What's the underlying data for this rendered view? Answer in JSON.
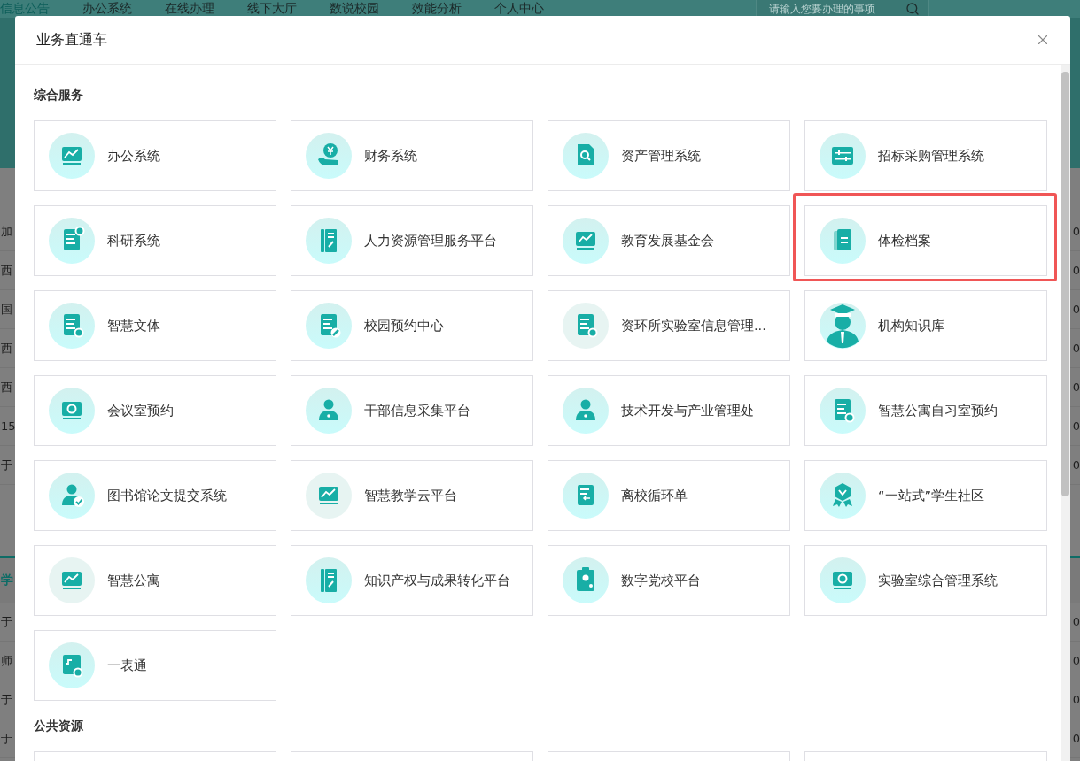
{
  "background_page": {
    "nav": [
      {
        "label": "信息公告",
        "selected": true
      },
      {
        "label": "办公系统",
        "selected": false
      },
      {
        "label": "在线办理",
        "selected": false
      },
      {
        "label": "线下大厅",
        "selected": false
      },
      {
        "label": "数说校园",
        "selected": false
      },
      {
        "label": "效能分析",
        "selected": false
      },
      {
        "label": "个人中心",
        "selected": false
      }
    ],
    "search": {
      "placeholder": "请输入您要办理的事项"
    },
    "list_1": {
      "rows": [
        {
          "column_1": "加",
          "column_2": "0"
        },
        {
          "column_1": "西",
          "column_2": "0"
        },
        {
          "column_1": "国",
          "column_2": "0"
        },
        {
          "column_1": "西",
          "column_2": "0"
        },
        {
          "column_1": "西",
          "column_2": "0"
        },
        {
          "column_1": "15",
          "column_2": "0"
        },
        {
          "column_1": "于",
          "column_2": "0"
        }
      ]
    },
    "list_2": {
      "heading": "学",
      "rows": [
        {
          "column_1": "于",
          "column_2": "0"
        },
        {
          "column_1": "师",
          "column_2": "0"
        },
        {
          "column_1": "于",
          "column_2": "0"
        },
        {
          "column_1": "于",
          "column_2": "0"
        }
      ]
    }
  },
  "dialog": {
    "title": "业务直通车",
    "sections": [
      {
        "title": "综合服务",
        "items": [
          {
            "kind": "app",
            "label": "办公系统",
            "highlighted": false
          },
          {
            "kind": "app",
            "label": "财务系统",
            "highlighted": false
          },
          {
            "kind": "app",
            "label": "资产管理系统",
            "highlighted": false
          },
          {
            "kind": "app",
            "label": "招标采购管理系统",
            "highlighted": false
          },
          {
            "kind": "app",
            "label": "科研系统",
            "highlighted": false
          },
          {
            "kind": "app",
            "label": "人力资源管理服务平台",
            "highlighted": false
          },
          {
            "kind": "app",
            "label": "教育发展基金会",
            "highlighted": false
          },
          {
            "kind": "app",
            "label": "体检档案",
            "highlighted": true
          },
          {
            "kind": "app",
            "label": "智慧文体",
            "highlighted": false
          },
          {
            "kind": "app",
            "label": "校园预约中心",
            "highlighted": false
          },
          {
            "kind": "app",
            "label": "资环所实验室信息管理...",
            "highlighted": false
          },
          {
            "kind": "app",
            "label": "机构知识库",
            "highlighted": false
          },
          {
            "kind": "app",
            "label": "会议室预约",
            "highlighted": false
          },
          {
            "kind": "app",
            "label": "干部信息采集平台",
            "highlighted": false
          },
          {
            "kind": "app",
            "label": "技术开发与产业管理处",
            "highlighted": false
          },
          {
            "kind": "app",
            "label": "智慧公寓自习室预约",
            "highlighted": false
          },
          {
            "kind": "app",
            "label": "图书馆论文提交系统",
            "highlighted": false
          },
          {
            "kind": "app",
            "label": "智慧教学云平台",
            "highlighted": false
          },
          {
            "kind": "app",
            "label": "离校循环单",
            "highlighted": false
          },
          {
            "kind": "app",
            "label": "“一站式”学生社区",
            "highlighted": false
          },
          {
            "kind": "app",
            "label": "智慧公寓",
            "highlighted": false
          },
          {
            "kind": "app",
            "label": "知识产权与成果转化平台",
            "highlighted": false
          },
          {
            "kind": "app",
            "label": "数字党校平台",
            "highlighted": false
          },
          {
            "kind": "app",
            "label": "实验室综合管理系统",
            "highlighted": false
          },
          {
            "kind": "app",
            "label": "一表通",
            "highlighted": false
          }
        ]
      },
      {
        "title": "公共资源",
        "items": [
          {
            "kind": "cut"
          },
          {
            "kind": "cut"
          },
          {
            "kind": "cut"
          },
          {
            "kind": "cut"
          }
        ]
      }
    ]
  }
}
